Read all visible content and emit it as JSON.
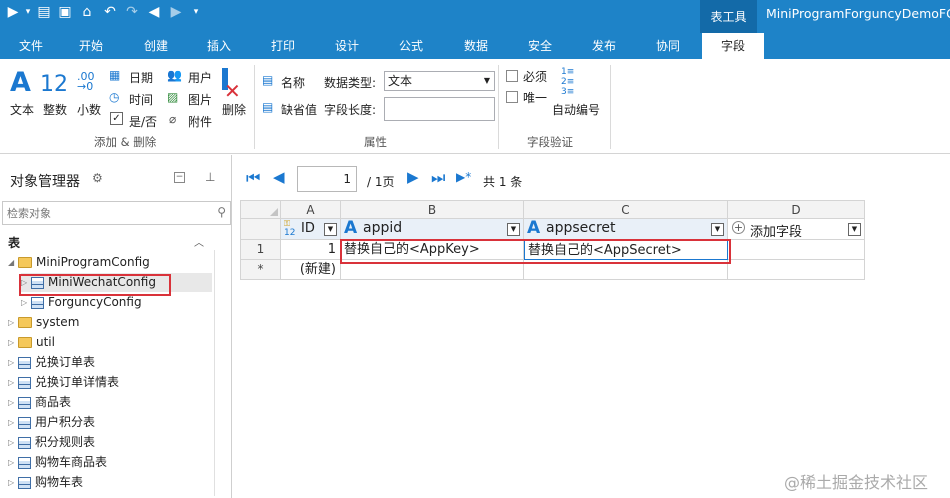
{
  "titlebar": {
    "context_tab": "表工具",
    "window_title": "MiniProgramForguncyDemoFGC"
  },
  "ribbon_tabs": [
    "文件",
    "开始",
    "创建",
    "插入",
    "打印",
    "设计",
    "公式",
    "数据",
    "安全",
    "发布",
    "协同",
    "字段"
  ],
  "active_tab": "字段",
  "ribbon": {
    "add_delete": {
      "text": "文本",
      "integer": "整数",
      "decimal": "小数",
      "date": "日期",
      "time": "时间",
      "yesno": "是/否",
      "user": "用户",
      "image": "图片",
      "attachment": "附件",
      "delete": "删除",
      "group_label": "添加 & 删除"
    },
    "properties": {
      "name_label": "名称",
      "default_label": "缺省值",
      "datatype_label": "数据类型:",
      "datatype_value": "文本",
      "length_label": "字段长度:",
      "length_value": "",
      "group_label": "属性"
    },
    "validation": {
      "required": "必须",
      "unique": "唯一",
      "auto_number": "自动编号",
      "group_label": "字段验证"
    }
  },
  "object_manager": {
    "title": "对象管理器",
    "search_placeholder": "检索对象",
    "section_title": "表",
    "tree": [
      {
        "label": "MiniProgramConfig",
        "type": "folder",
        "level": 0,
        "expanded": true
      },
      {
        "label": "MiniWechatConfig",
        "type": "table",
        "level": 1,
        "selected": true
      },
      {
        "label": "ForguncyConfig",
        "type": "table",
        "level": 1
      },
      {
        "label": "system",
        "type": "folder",
        "level": 0
      },
      {
        "label": "util",
        "type": "folder",
        "level": 0
      },
      {
        "label": "兑换订单表",
        "type": "table",
        "level": 0
      },
      {
        "label": "兑换订单详情表",
        "type": "table",
        "level": 0
      },
      {
        "label": "商品表",
        "type": "table",
        "level": 0
      },
      {
        "label": "用户积分表",
        "type": "table",
        "level": 0
      },
      {
        "label": "积分规则表",
        "type": "table",
        "level": 0
      },
      {
        "label": "购物车商品表",
        "type": "table",
        "level": 0
      },
      {
        "label": "购物车表",
        "type": "table",
        "level": 0
      }
    ]
  },
  "navigation": {
    "page_value": "1",
    "page_total": "/ 1页",
    "record_count": "共 1 条"
  },
  "grid": {
    "column_letters": [
      "A",
      "B",
      "C",
      "D"
    ],
    "field_headers": [
      "ID",
      "appid",
      "appsecret",
      "添加字段"
    ],
    "rows": [
      {
        "row_header": "1",
        "id": "1",
        "appid": "替换自己的<AppKey>",
        "appsecret": "替换自己的<AppSecret>"
      },
      {
        "row_header": "*",
        "id": "(新建)",
        "appid": "",
        "appsecret": ""
      }
    ]
  },
  "watermark": "@稀土掘金技术社区",
  "colors": {
    "title_blue": "#1e83c8",
    "context_tab_blue": "#136aa8",
    "highlight_red": "#d9323a",
    "nav_blue": "#1b78d0"
  }
}
